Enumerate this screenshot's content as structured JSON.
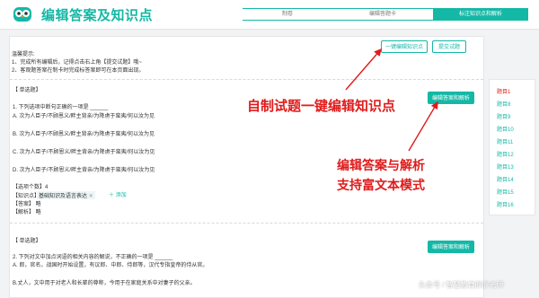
{
  "header": {
    "title": "编辑答案及知识点",
    "steps": [
      "制卷",
      "编辑答题卡",
      "标注知识点和解析"
    ]
  },
  "main": {
    "tips_title": "温馨提示:",
    "tips": [
      "1、完成所有编辑后，记得点击右上角【提交试题】哦~",
      "2、客观题答案在制卡时完成标答案即可在本页面出现。"
    ],
    "buttons": {
      "one_click": "一键编辑知识点",
      "submit": "提交试题",
      "edit_answer": "编辑答案和解析"
    },
    "q1": {
      "type": "【 单选题】",
      "stem": "1. 下列选项中断句正确的一项是 ______",
      "options": [
        "A. 次为人臣子/不顾恩义/畔主背亲/为降虏于蛮夷/何以汝为见",
        "B. 次为人臣子/不顾恩义/畔主背亲/为降虏于蛮夷/何以汝为见",
        "C. 次为人臣子/不顾恩义/畔主背亲/为降虏于蛮夷/何以汝为见",
        "D. 次为人臣子/不顾恩义/畔主背亲/为降虏于蛮夷/何以汝为见"
      ],
      "option_count": "【选项个数】4",
      "knowledge_label": "【知识点】",
      "knowledge_value": "基础知识及语言表达",
      "add_label": "添加",
      "answer": "【答案】 略",
      "analysis": "【解析】 略"
    },
    "q2": {
      "type": "【 单选题】",
      "stem": "2. 下列对文中加点词语的相关内容的解说，不正确的一项是 ______",
      "option_a": "A. 郎，官名，战国时开始设置，有议郎、中郎、侍郎等，汉代专指皇帝的侍从官。",
      "option_b": "B.丈人，文中用于对老人和长辈的尊称，今用于在家庭关系中对妻子的父亲。"
    }
  },
  "annotations": {
    "one_click_note": "自制试题一键编辑知识点",
    "rich_text_note_1": "编辑答案与解析",
    "rich_text_note_2": "支持富文本模式"
  },
  "sidebar": {
    "items": [
      "题目1",
      "题目8",
      "题目9",
      "题目10",
      "题目11",
      "题目12",
      "题目13",
      "题目14",
      "题目15",
      "题目16"
    ]
  },
  "watermark": "头条号 / 智慧教育胖胖老师",
  "colors": {
    "accent": "#14b8a6",
    "annotation": "#e01b1b"
  }
}
